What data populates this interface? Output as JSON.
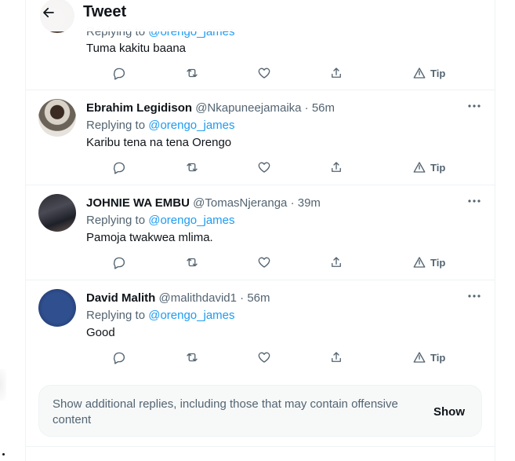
{
  "header": {
    "title": "Tweet"
  },
  "tweets": [
    {
      "name": "",
      "handle": "",
      "time": "",
      "replying_prefix": "Replying to",
      "replying_to": "@orengo_james",
      "text": "Tuma kakitu baana",
      "tip_label": "Tip"
    },
    {
      "name": "Ebrahim Legidison",
      "handle": "@Nkapuneejamaika",
      "time": "· 56m",
      "replying_prefix": "Replying to",
      "replying_to": "@orengo_james",
      "text": "Karibu tena na tena Orengo",
      "tip_label": "Tip"
    },
    {
      "name": "JOHNIE WA EMBU",
      "handle": "@TomasNjeranga",
      "time": "· 39m",
      "replying_prefix": "Replying to",
      "replying_to": "@orengo_james",
      "text": "Pamoja twakwea mlima.",
      "tip_label": "Tip"
    },
    {
      "name": "David Malith",
      "handle": "@malithdavid1",
      "time": "· 56m",
      "replying_prefix": "Replying to",
      "replying_to": "@orengo_james",
      "text": "Good",
      "tip_label": "Tip"
    }
  ],
  "show_more": {
    "text": "Show additional replies, including those that may contain offensive content",
    "button": "Show"
  },
  "colors": {
    "link": "#1d9bf0",
    "muted": "#536471",
    "text": "#0f1419"
  }
}
